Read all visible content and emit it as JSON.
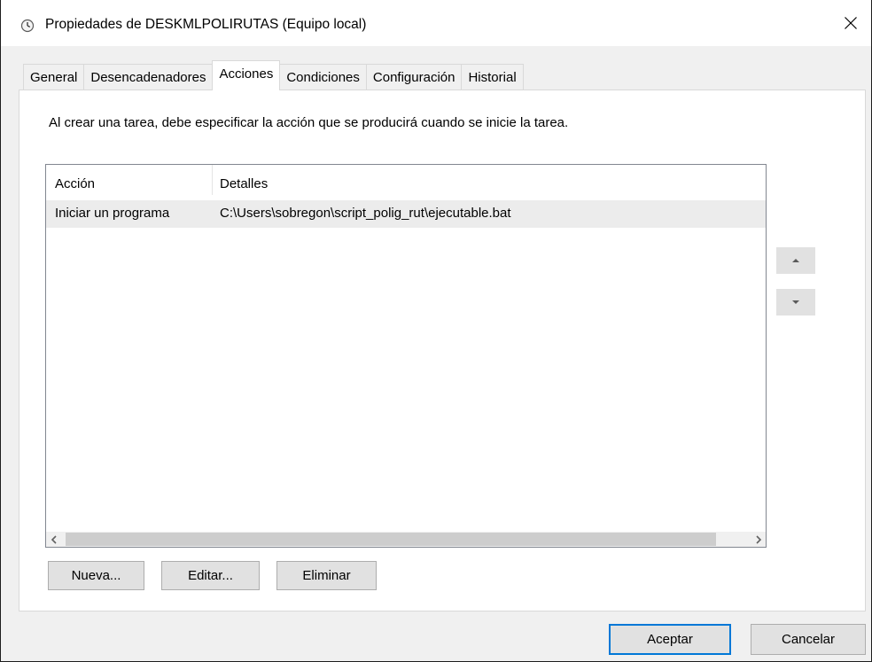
{
  "window": {
    "title": "Propiedades de DESKMLPOLIRUTAS (Equipo local)",
    "icon": "clock-icon",
    "close_glyph": "✕"
  },
  "tabs": [
    {
      "label": "General",
      "active": false
    },
    {
      "label": "Desencadenadores",
      "active": false
    },
    {
      "label": "Acciones",
      "active": true
    },
    {
      "label": "Condiciones",
      "active": false
    },
    {
      "label": "Configuración",
      "active": false
    },
    {
      "label": "Historial",
      "active": false
    }
  ],
  "actions_panel": {
    "description": "Al crear una tarea, debe especificar la acción que se producirá cuando se inicie la tarea.",
    "columns": [
      "Acción",
      "Detalles"
    ],
    "rows": [
      {
        "action": "Iniciar un programa",
        "details": "C:\\Users\\sobregon\\script_polig_rut\\ejecutable.bat"
      }
    ],
    "buttons": {
      "new": "Nueva...",
      "edit": "Editar...",
      "delete": "Eliminar"
    }
  },
  "dialog_buttons": {
    "ok": "Aceptar",
    "cancel": "Cancelar"
  },
  "colors": {
    "accent": "#0078d7",
    "selection_row": "#ececec"
  }
}
